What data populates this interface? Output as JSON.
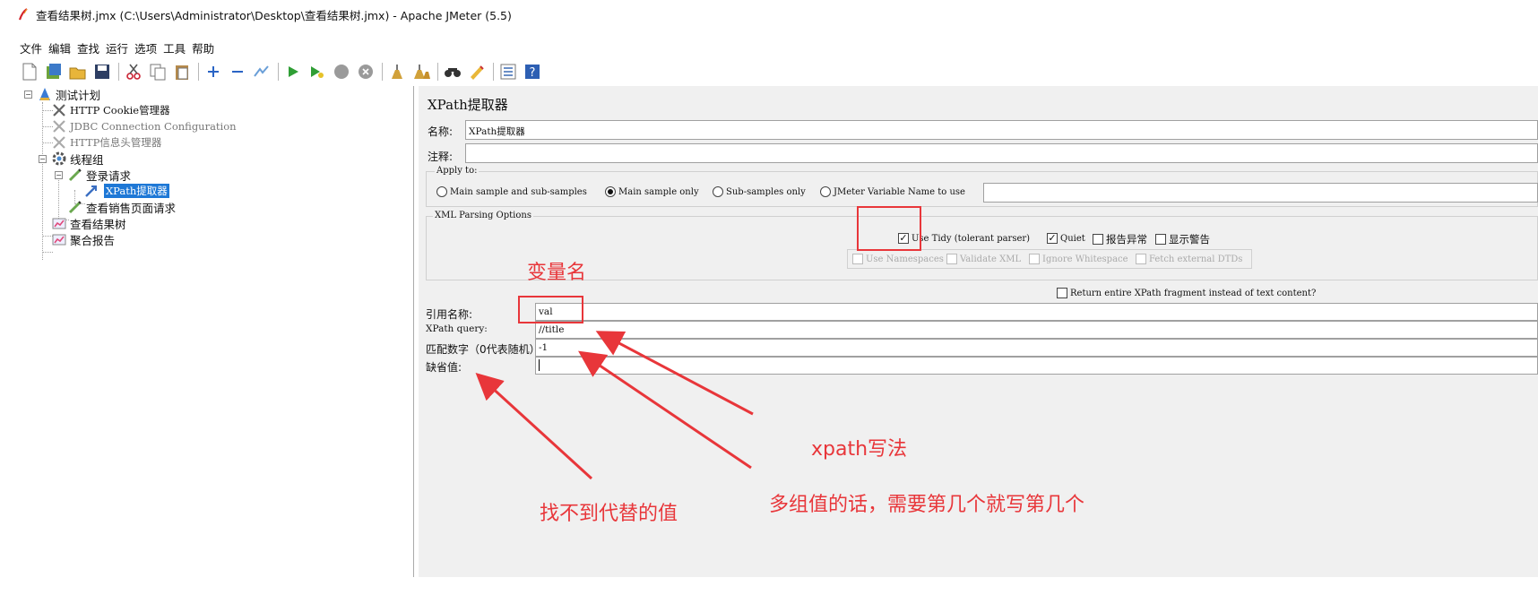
{
  "window": {
    "title": "查看结果树.jmx (C:\\Users\\Administrator\\Desktop\\查看结果树.jmx) - Apache JMeter (5.5)"
  },
  "menu": [
    "文件",
    "编辑",
    "查找",
    "运行",
    "选项",
    "工具",
    "帮助"
  ],
  "tree": {
    "plan": "测试计划",
    "cookie": "HTTP Cookie管理器",
    "jdbc": "JDBC Connection Configuration",
    "header": "HTTP信息头管理器",
    "thread_group": "线程组",
    "login": "登录请求",
    "xpath": "XPath提取器",
    "sales": "查看销售页面请求",
    "results_tree": "查看结果树",
    "aggregate": "聚合报告"
  },
  "panel": {
    "title": "XPath提取器",
    "name_label": "名称:",
    "name_value": "XPath提取器",
    "comment_label": "注释:",
    "comment_value": "",
    "apply_to": {
      "title": "Apply to:",
      "options": [
        "Main sample and sub-samples",
        "Main sample only",
        "Sub-samples only",
        "JMeter Variable Name to use"
      ],
      "selected": "Main sample only",
      "variable_value": ""
    },
    "xml_options": {
      "title": "XML Parsing Options",
      "use_tidy": "Use Tidy (tolerant parser)",
      "quiet": "Quiet",
      "report_errors": "报告异常",
      "show_warnings": "显示警告",
      "use_namespaces": "Use Namespaces",
      "validate_xml": "Validate XML",
      "ignore_whitespace": "Ignore Whitespace",
      "fetch_dtds": "Fetch external DTDs"
    },
    "return_fragment": "Return entire XPath fragment instead of text content?",
    "ref_name_label": "引用名称:",
    "ref_name_value": "val",
    "xpath_query_label": "XPath query:",
    "xpath_query_value": "//title",
    "match_no_label": "匹配数字（0代表随机）:",
    "match_no_value": "-1",
    "default_label": "缺省值:",
    "default_value": ""
  },
  "annotations": {
    "var_name": "变量名",
    "xpath_syntax": "xpath写法",
    "multi_values": "多组值的话，需要第几个就写第几个",
    "default_hint": "找不到代替的值"
  },
  "colors": {
    "annotation": "#e8363a",
    "selection": "#1e78d6",
    "panel_bg": "#f0f0f0"
  },
  "toolbar_icons": [
    "new-icon",
    "templates-icon",
    "open-icon",
    "save-icon",
    "cut-icon",
    "copy-icon",
    "paste-icon",
    "expand-icon",
    "collapse-icon",
    "toggle-icon",
    "start-icon",
    "start-no-pause-icon",
    "stop-icon",
    "shutdown-icon",
    "clear-icon",
    "clear-all-icon",
    "search-icon",
    "reset-search-icon",
    "function-helper-icon",
    "help-icon"
  ]
}
